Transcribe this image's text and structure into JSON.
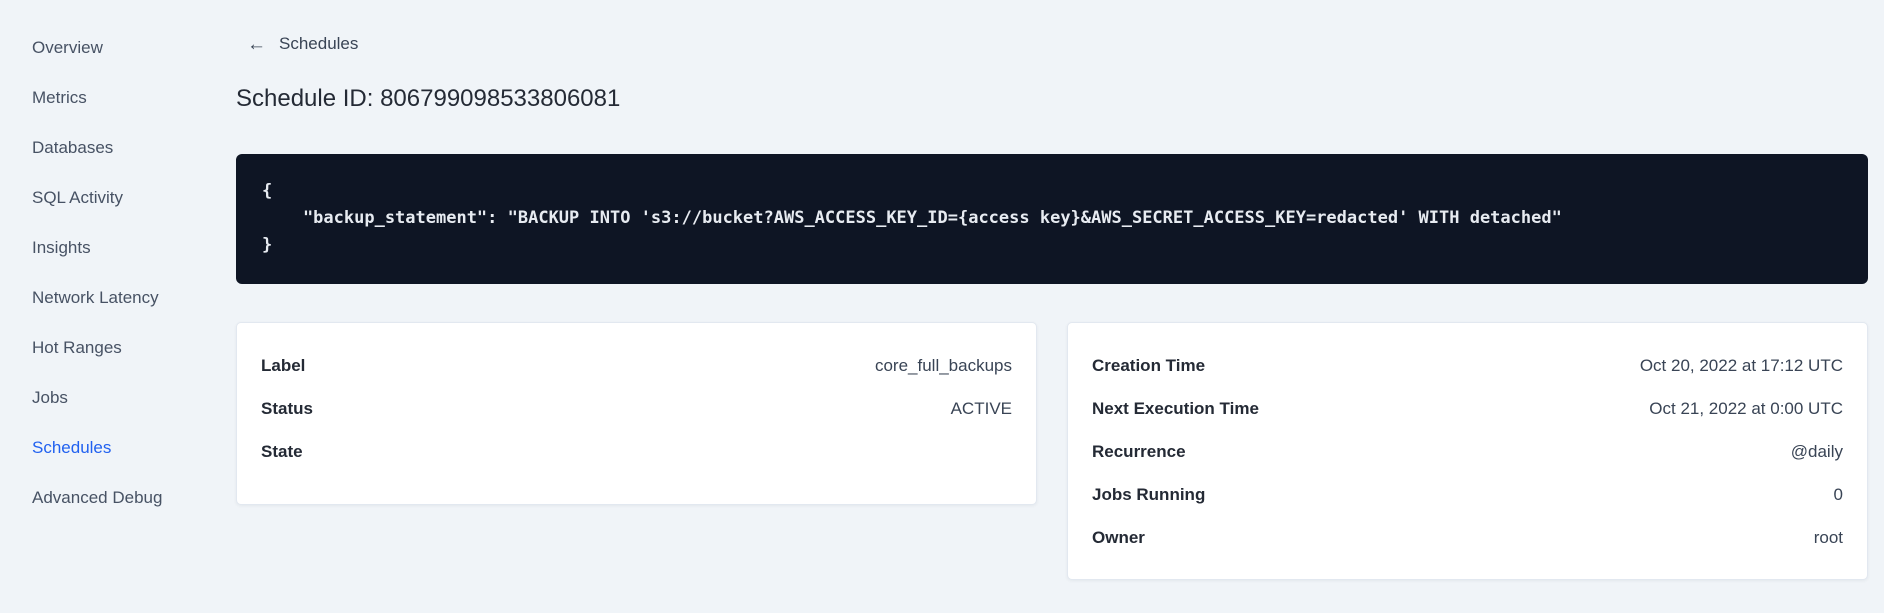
{
  "sidebar": {
    "items": [
      {
        "label": "Overview"
      },
      {
        "label": "Metrics"
      },
      {
        "label": "Databases"
      },
      {
        "label": "SQL Activity"
      },
      {
        "label": "Insights"
      },
      {
        "label": "Network Latency"
      },
      {
        "label": "Hot Ranges"
      },
      {
        "label": "Jobs"
      },
      {
        "label": "Schedules"
      },
      {
        "label": "Advanced Debug"
      }
    ],
    "active_item": "Schedules"
  },
  "header": {
    "back_icon": "arrow-left",
    "back_arrow_glyph": "←",
    "back_label": "Schedules",
    "title": "Schedule ID: 806799098533806081"
  },
  "code_block": {
    "language": "json",
    "code": "{\n    \"backup_statement\": \"BACKUP INTO 's3://bucket?AWS_ACCESS_KEY_ID={access key}&AWS_SECRET_ACCESS_KEY=redacted' WITH detached\"\n}"
  },
  "cards": {
    "schedule_details": {
      "rows": [
        {
          "label": "Label",
          "value": "core_full_backups"
        },
        {
          "label": "Status",
          "value": "ACTIVE"
        },
        {
          "label": "State",
          "value": ""
        }
      ]
    },
    "execution_details": {
      "rows": [
        {
          "label": "Creation Time",
          "value": "Oct 20, 2022 at 17:12 UTC"
        },
        {
          "label": "Next Execution Time",
          "value": "Oct 21, 2022 at 0:00 UTC"
        },
        {
          "label": "Recurrence",
          "value": "@daily"
        },
        {
          "label": "Jobs Running",
          "value": "0"
        },
        {
          "label": "Owner",
          "value": "root"
        }
      ]
    }
  },
  "colors": {
    "page_background": "#f0f4f8",
    "sidebar_text": "#475264",
    "sidebar_active": "#2161f0",
    "heading_text": "#242a35",
    "code_background": "#0e1524",
    "code_text": "#e7ebf1",
    "card_background": "#ffffff",
    "card_border": "#e2e8f0",
    "label_text": "#242a35",
    "value_text": "#394455"
  }
}
